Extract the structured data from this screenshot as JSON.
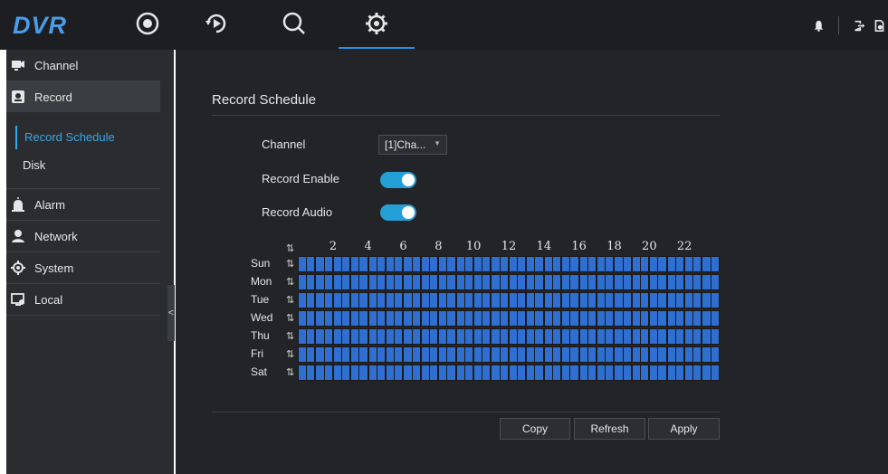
{
  "app": {
    "logo": "DVR"
  },
  "topnav": {
    "items": [
      {
        "name": "live-view",
        "icon": "live-view-icon"
      },
      {
        "name": "playback",
        "icon": "playback-icon"
      },
      {
        "name": "search",
        "icon": "search-icon"
      },
      {
        "name": "settings",
        "icon": "gear-icon",
        "active": true
      }
    ],
    "right_icons": [
      "bell-icon",
      "logout-icon",
      "lock-file-icon"
    ]
  },
  "sidebar": {
    "items": [
      {
        "label": "Channel",
        "icon": "camera-icon"
      },
      {
        "label": "Record",
        "icon": "record-icon",
        "active": true
      },
      {
        "label": "Alarm",
        "icon": "alarm-icon"
      },
      {
        "label": "Network",
        "icon": "network-icon"
      },
      {
        "label": "System",
        "icon": "system-gear-icon"
      },
      {
        "label": "Local",
        "icon": "monitor-icon"
      }
    ],
    "sub_items": [
      {
        "label": "Record Schedule",
        "active": true
      },
      {
        "label": "Disk"
      }
    ],
    "collapse_glyph": "<"
  },
  "main": {
    "title": "Record Schedule",
    "channel": {
      "label": "Channel",
      "value": "[1]Cha..."
    },
    "record_enable": {
      "label": "Record Enable",
      "on": true
    },
    "record_audio": {
      "label": "Record Audio",
      "on": true
    },
    "schedule": {
      "hour_labels": [
        "2",
        "4",
        "6",
        "8",
        "10",
        "12",
        "14",
        "16",
        "18",
        "20",
        "22"
      ],
      "days": [
        "Sun",
        "Mon",
        "Tue",
        "Wed",
        "Thu",
        "Fri",
        "Sat"
      ],
      "cell_color": "#2f6fd1"
    },
    "buttons": {
      "copy": "Copy",
      "refresh": "Refresh",
      "apply": "Apply"
    }
  },
  "colors": {
    "accent": "#3aa7e8",
    "toggle_on": "#25a0d6",
    "logo": "#4a9de8"
  }
}
